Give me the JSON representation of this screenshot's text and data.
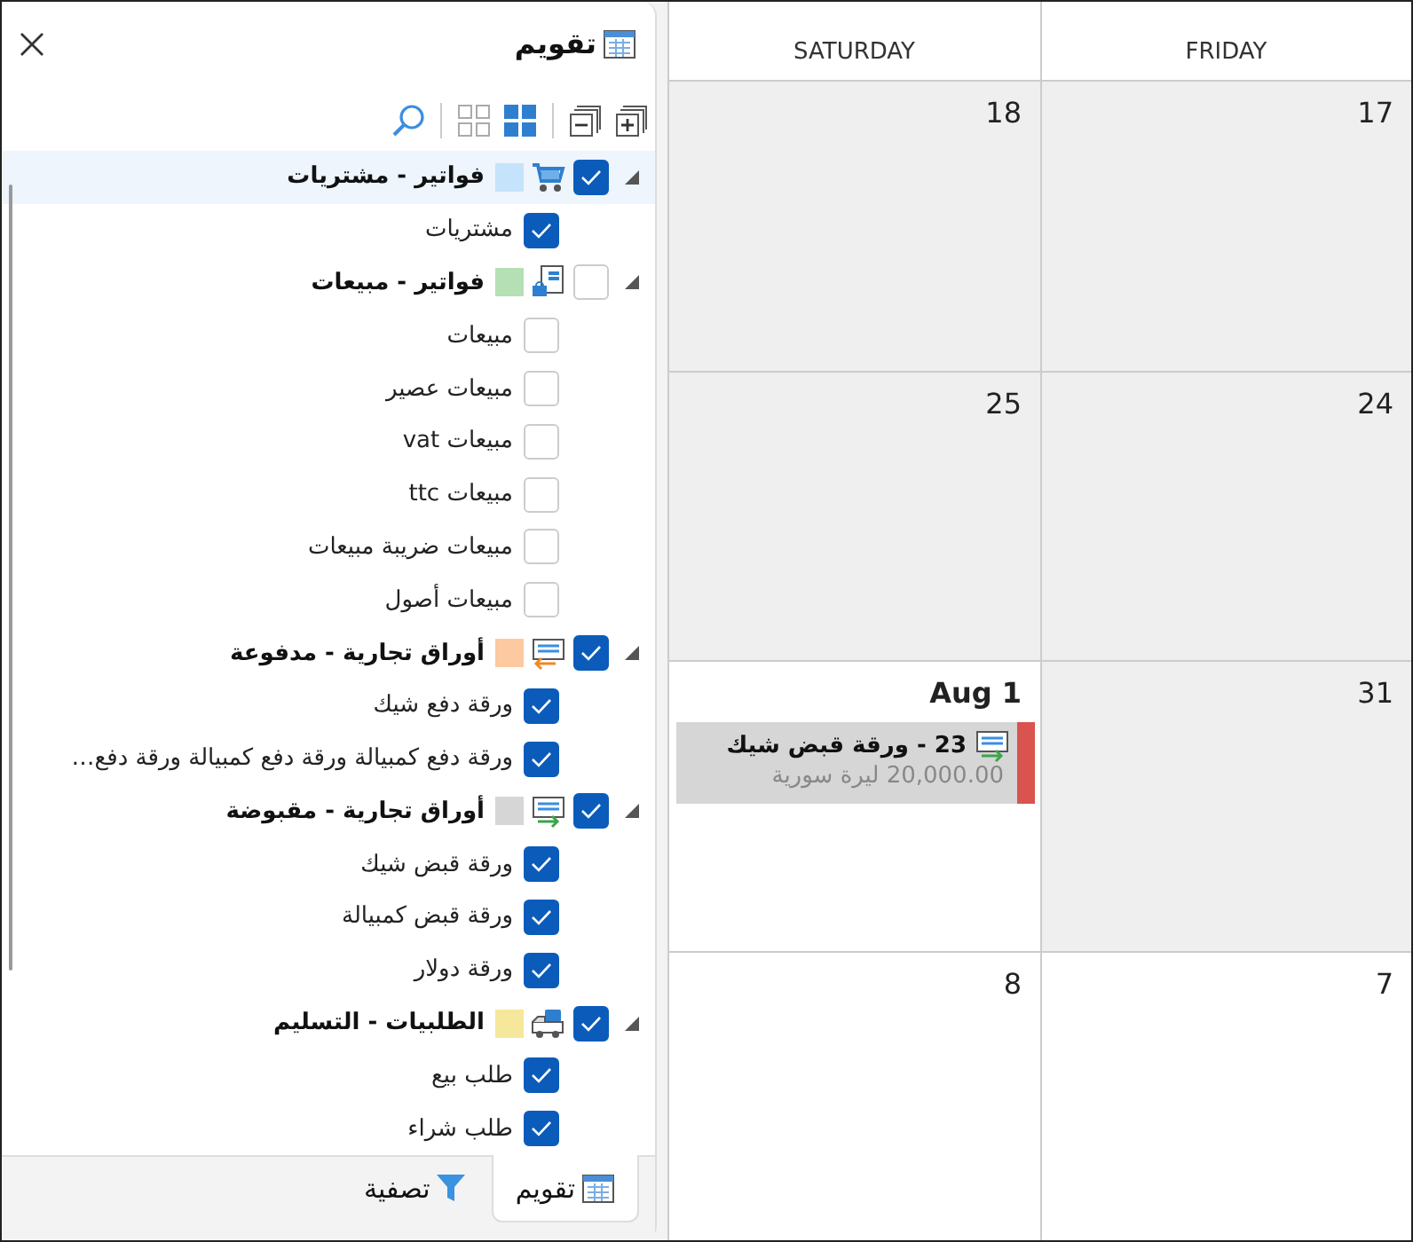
{
  "panel": {
    "title": "تقويم",
    "view_modes": [
      {
        "selected": true
      },
      {
        "selected": false
      }
    ],
    "groups": [
      {
        "label": "فواتير - مشتريات",
        "kind": "cart",
        "color": "#c5e3fa",
        "checked": true,
        "expanded": true,
        "selected": true,
        "children": [
          {
            "label": "مشتريات",
            "checked": true
          }
        ]
      },
      {
        "label": "فواتير - مبيعات",
        "kind": "invoice",
        "color": "#b5e0b5",
        "checked": false,
        "expanded": true,
        "selected": false,
        "children": [
          {
            "label": "مبيعات",
            "checked": false
          },
          {
            "label": "مبيعات عصير",
            "checked": false
          },
          {
            "label": "مبيعات vat",
            "checked": false
          },
          {
            "label": "مبيعات ttc",
            "checked": false
          },
          {
            "label": "مبيعات ضريبة مبيعات",
            "checked": false
          },
          {
            "label": "مبيعات أصول",
            "checked": false
          }
        ]
      },
      {
        "label": "أوراق تجارية - مدفوعة",
        "kind": "paper-out",
        "color": "#fdc9a0",
        "checked": true,
        "expanded": true,
        "selected": false,
        "children": [
          {
            "label": "ورقة دفع شيك",
            "checked": true
          },
          {
            "label": "ورقة دفع كمبيالة ورقة دفع كمبيالة ورقة دفع…",
            "checked": true
          }
        ]
      },
      {
        "label": "أوراق تجارية - مقبوضة",
        "kind": "paper-in",
        "color": "#d6d6d6",
        "checked": true,
        "expanded": true,
        "selected": false,
        "children": [
          {
            "label": "ورقة قبض شيك",
            "checked": true
          },
          {
            "label": "ورقة قبض كمبيالة",
            "checked": true
          },
          {
            "label": "ورقة دولار",
            "checked": true
          }
        ]
      },
      {
        "label": "الطلبيات - التسليم",
        "kind": "truck",
        "color": "#f6e89a",
        "checked": true,
        "expanded": true,
        "selected": false,
        "children": [
          {
            "label": "طلب بيع",
            "checked": true
          },
          {
            "label": "طلب شراء",
            "checked": true
          }
        ]
      }
    ],
    "tabs": [
      {
        "label": "تقويم",
        "kind": "calendar",
        "selected": true
      },
      {
        "label": "تصفية",
        "kind": "filter",
        "selected": false
      }
    ]
  },
  "calendar": {
    "columns": [
      "FRIDAY",
      "SATURDAY"
    ],
    "weeks": [
      [
        {
          "day": "17",
          "shaded": true,
          "month_start": false
        },
        {
          "day": "18",
          "shaded": true,
          "month_start": false
        }
      ],
      [
        {
          "day": "24",
          "shaded": true,
          "month_start": false
        },
        {
          "day": "25",
          "shaded": true,
          "month_start": false
        }
      ],
      [
        {
          "day": "31",
          "shaded": true,
          "month_start": false
        },
        {
          "day": "Aug 1",
          "shaded": false,
          "month_start": true,
          "events": [
            {
              "title": "23 - ورقة قبض شيك",
              "amount": "20,000.00 ليرة سورية",
              "kind": "paper-in",
              "color": "#d9534f"
            }
          ]
        }
      ],
      [
        {
          "day": "7",
          "shaded": false,
          "month_start": false
        },
        {
          "day": "8",
          "shaded": false,
          "month_start": false
        }
      ]
    ]
  }
}
